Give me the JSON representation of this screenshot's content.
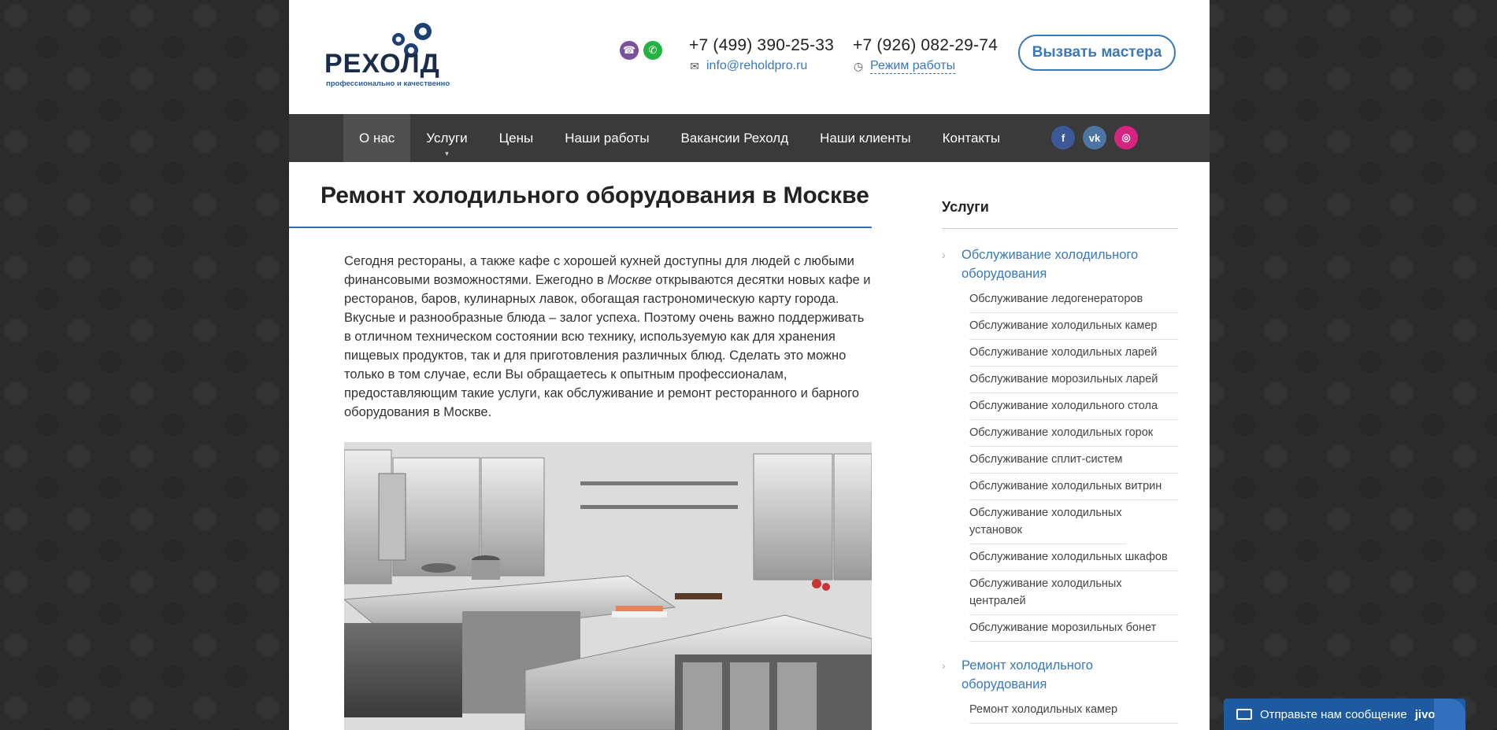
{
  "header": {
    "logo_word": "РЕХОЛД",
    "logo_tagline": "профессионально и качественно",
    "messengers": [
      "viber-icon",
      "whatsapp-icon"
    ],
    "phone_1": "+7 (499) 390-25-33",
    "email": "info@reholdpro.ru",
    "phone_2": "+7 (926) 082-29-74",
    "hours_link": "Режим работы",
    "call_button": "Вызвать мастера"
  },
  "nav": {
    "items": [
      {
        "label": "О нас"
      },
      {
        "label": "Услуги"
      },
      {
        "label": "Цены"
      },
      {
        "label": "Наши работы"
      },
      {
        "label": "Вакансии Рехолд"
      },
      {
        "label": "Наши клиенты"
      },
      {
        "label": "Контакты"
      }
    ],
    "socials": [
      {
        "icon": "facebook-icon",
        "glyph": "f"
      },
      {
        "icon": "vk-icon",
        "glyph": "vk"
      },
      {
        "icon": "instagram-icon",
        "glyph": "◎"
      }
    ]
  },
  "main": {
    "title": "Ремонт холодильного оборудования в Москве",
    "intro_before": "Сегодня рестораны, а также кафе с хорошей кухней доступны для людей с любыми финансовыми возможностями. Ежегодно в ",
    "intro_italic": "Москве",
    "intro_after": " открываются десятки новых кафе и ресторанов, баров, кулинарных лавок, обогащая гастрономическую карту города. Вкусные и разнообразные блюда – залог успеха. Поэтому очень важно поддерживать в отличном техническом состоянии всю технику, используемую как для хранения пищевых продуктов, так и для приготовления различных блюд. Сделать это можно только в том случае, если Вы обращаетесь к опытным профессионалам, предоставляющим такие услуги, как обслуживание и ремонт ресторанного и барного оборудования в Москве."
  },
  "sidebar": {
    "title": "Услуги",
    "category_1": "Обслуживание холодильного оборудования",
    "sub_1": [
      "Обслуживание ледогенераторов",
      "Обслуживание холодильных камер",
      "Обслуживание холодильных ларей",
      "Обслуживание морозильных ларей",
      "Обслуживание холодильного стола",
      "Обслуживание холодильных горок",
      "Обслуживание сплит-систем",
      "Обслуживание холодильных витрин",
      "Обслуживание холодильных установок",
      "Обслуживание холодильных шкафов",
      "Обслуживание холодильных централей",
      "Обслуживание морозильных бонет"
    ],
    "category_2": "Ремонт холодильного оборудования",
    "sub_2": [
      "Ремонт холодильных камер"
    ]
  },
  "chat": {
    "label": "Отправьте нам сообщение",
    "brand": "jivo"
  },
  "colors": {
    "accent": "#3a78b8",
    "nav_bg": "#3a3a3a",
    "title_rule": "#3a6ea8",
    "chat_bg": "#1d5aa0"
  }
}
